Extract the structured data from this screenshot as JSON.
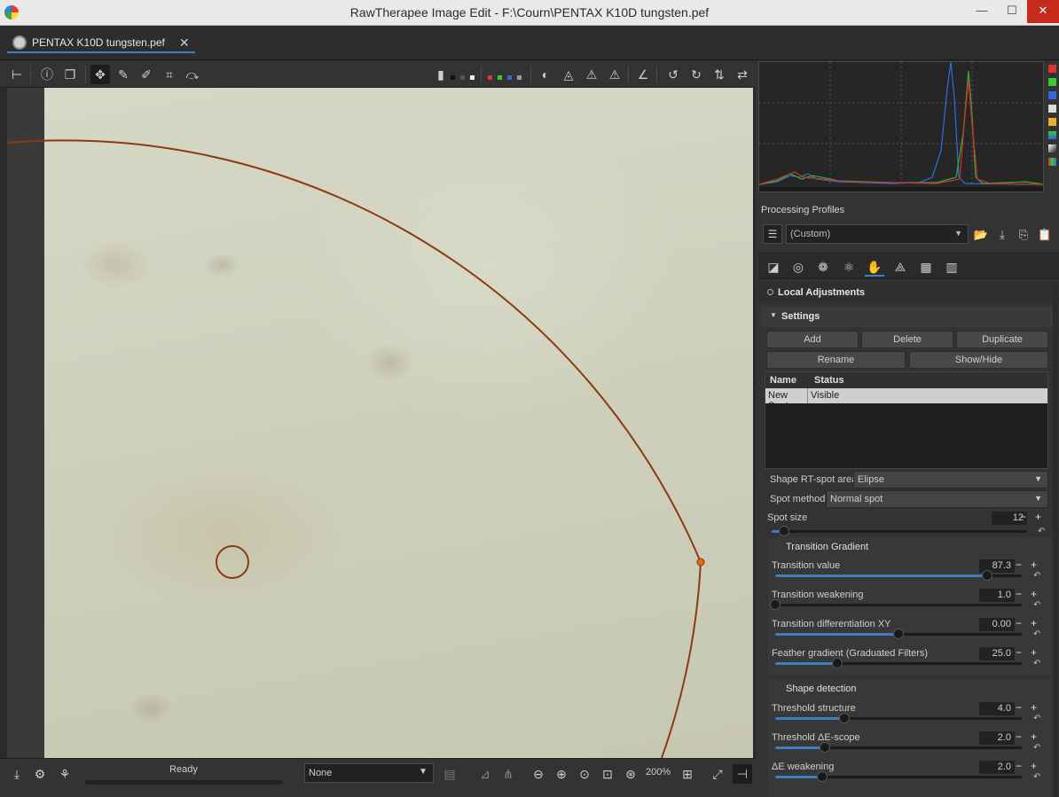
{
  "window": {
    "title": "RawTherapee Image Edit - F:\\Courn\\PENTAX K10D tungsten.pef",
    "minimize": "—",
    "maximize": "☐",
    "close": "✕"
  },
  "tab": {
    "label": "PENTAX K10D tungsten.pef",
    "close": "✕"
  },
  "status": {
    "text": "Ready",
    "combo_value": "None",
    "zoom": "200%"
  },
  "right_panel": {
    "processing_profiles_label": "Processing Profiles",
    "profile_value": "(Custom)",
    "local_adjustments_title": "Local Adjustments",
    "settings_title": "Settings",
    "buttons": {
      "add": "Add",
      "delete": "Delete",
      "duplicate": "Duplicate",
      "rename": "Rename",
      "show_hide": "Show/Hide"
    },
    "table": {
      "columns": [
        "Name",
        "Status"
      ],
      "rows": [
        {
          "name": "New Spot",
          "status": "Visible"
        }
      ]
    },
    "shape_label": "Shape RT-spot area:",
    "shape_value": "Elipse",
    "method_label": "Spot method:",
    "method_value": "Normal spot",
    "spot_size": {
      "label": "Spot size",
      "value": "12",
      "fraction": 0.05
    },
    "transition_gradient": {
      "title": "Transition Gradient",
      "sliders": [
        {
          "label": "Transition value",
          "value": "87.3",
          "fraction": 0.86
        },
        {
          "label": "Transition weakening",
          "value": "1.0",
          "fraction": 0.0
        },
        {
          "label": "Transition differentiation XY",
          "value": "0.00",
          "fraction": 0.5
        },
        {
          "label": "Feather gradient (Graduated Filters)",
          "value": "25.0",
          "fraction": 0.25
        }
      ]
    },
    "shape_detection": {
      "title": "Shape detection",
      "sliders": [
        {
          "label": "Threshold structure",
          "value": "4.0",
          "fraction": 0.28
        },
        {
          "label": "Threshold ΔE-scope",
          "value": "2.0",
          "fraction": 0.2
        },
        {
          "label": "ΔE weakening",
          "value": "2.0",
          "fraction": 0.19
        }
      ]
    }
  },
  "colors": {
    "accent": "#3e7cc4",
    "spot_outline": "#8b3a14",
    "histo_red": "#d03030",
    "histo_green": "#30b030",
    "histo_blue": "#2f6fe0"
  }
}
